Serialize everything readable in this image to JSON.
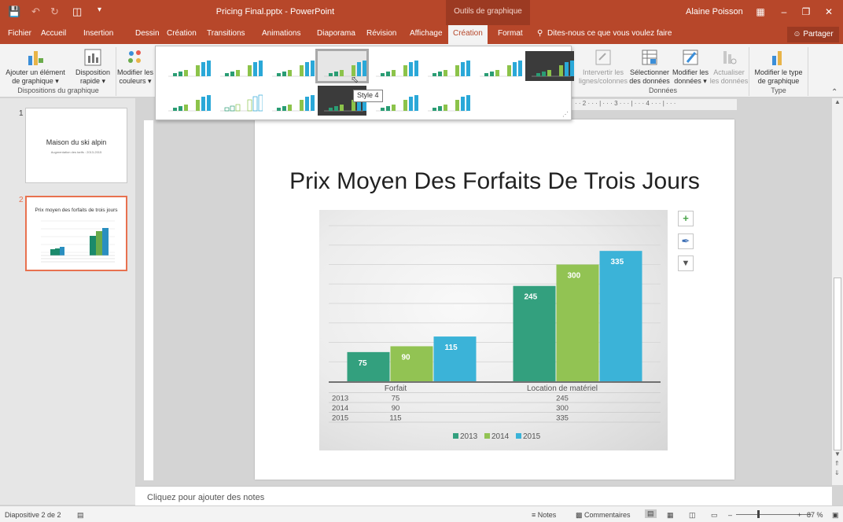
{
  "window": {
    "title": "Pricing Final.pptx - PowerPoint",
    "contextual_group": "Outils de graphique",
    "user": "Alaine Poisson"
  },
  "tabs": [
    {
      "label": "Fichier"
    },
    {
      "label": "Accueil"
    },
    {
      "label": "Insertion"
    },
    {
      "label": "Dessin"
    },
    {
      "label": "Création"
    },
    {
      "label": "Transitions"
    },
    {
      "label": "Animations"
    },
    {
      "label": "Diaporama"
    },
    {
      "label": "Révision"
    },
    {
      "label": "Affichage"
    },
    {
      "label": "Création"
    },
    {
      "label": "Format"
    }
  ],
  "tell_me": "Dites-nous ce que vous voulez faire",
  "share_label": "Partager",
  "ribbon": {
    "add_element": "Ajouter un élément de graphique",
    "quick_layout": "Disposition rapide",
    "change_colors": "Modifier les couleurs",
    "group_layouts": "Dispositions du graphique",
    "switch_rows": "Intervertir les lignes/colonnes",
    "select_data": "Sélectionner des données",
    "edit_data": "Modifier les données",
    "refresh_data": "Actualiser les données",
    "group_data": "Données",
    "change_type": "Modifier le type de graphique",
    "group_type": "Type"
  },
  "gallery": {
    "tooltip": "Style 4",
    "selected_index": 3
  },
  "slides": [
    {
      "number": "1",
      "title": "Maison du ski alpin",
      "subtitle": "Augmentation des tarifs : 2013-2015"
    },
    {
      "number": "2",
      "title": "Prix moyen des forfaits de trois jours"
    }
  ],
  "slide": {
    "title": "Prix Moyen Des Forfaits De Trois Jours"
  },
  "chart_data": {
    "type": "bar",
    "categories": [
      "Forfait",
      "Location de matériel"
    ],
    "series": [
      {
        "name": "2013",
        "values": [
          75,
          245
        ],
        "color": "#33a07e"
      },
      {
        "name": "2014",
        "values": [
          90,
          300
        ],
        "color": "#92c353"
      },
      {
        "name": "2015",
        "values": [
          115,
          335
        ],
        "color": "#3bb3d8"
      }
    ],
    "ylim": [
      0,
      400
    ],
    "grid": true,
    "legend": "bottom",
    "data_table": true
  },
  "notes_placeholder": "Cliquez pour ajouter des notes",
  "status": {
    "slide_indicator": "Diapositive 2 de 2",
    "notes": "Notes",
    "comments": "Commentaires",
    "zoom": "87 %"
  }
}
